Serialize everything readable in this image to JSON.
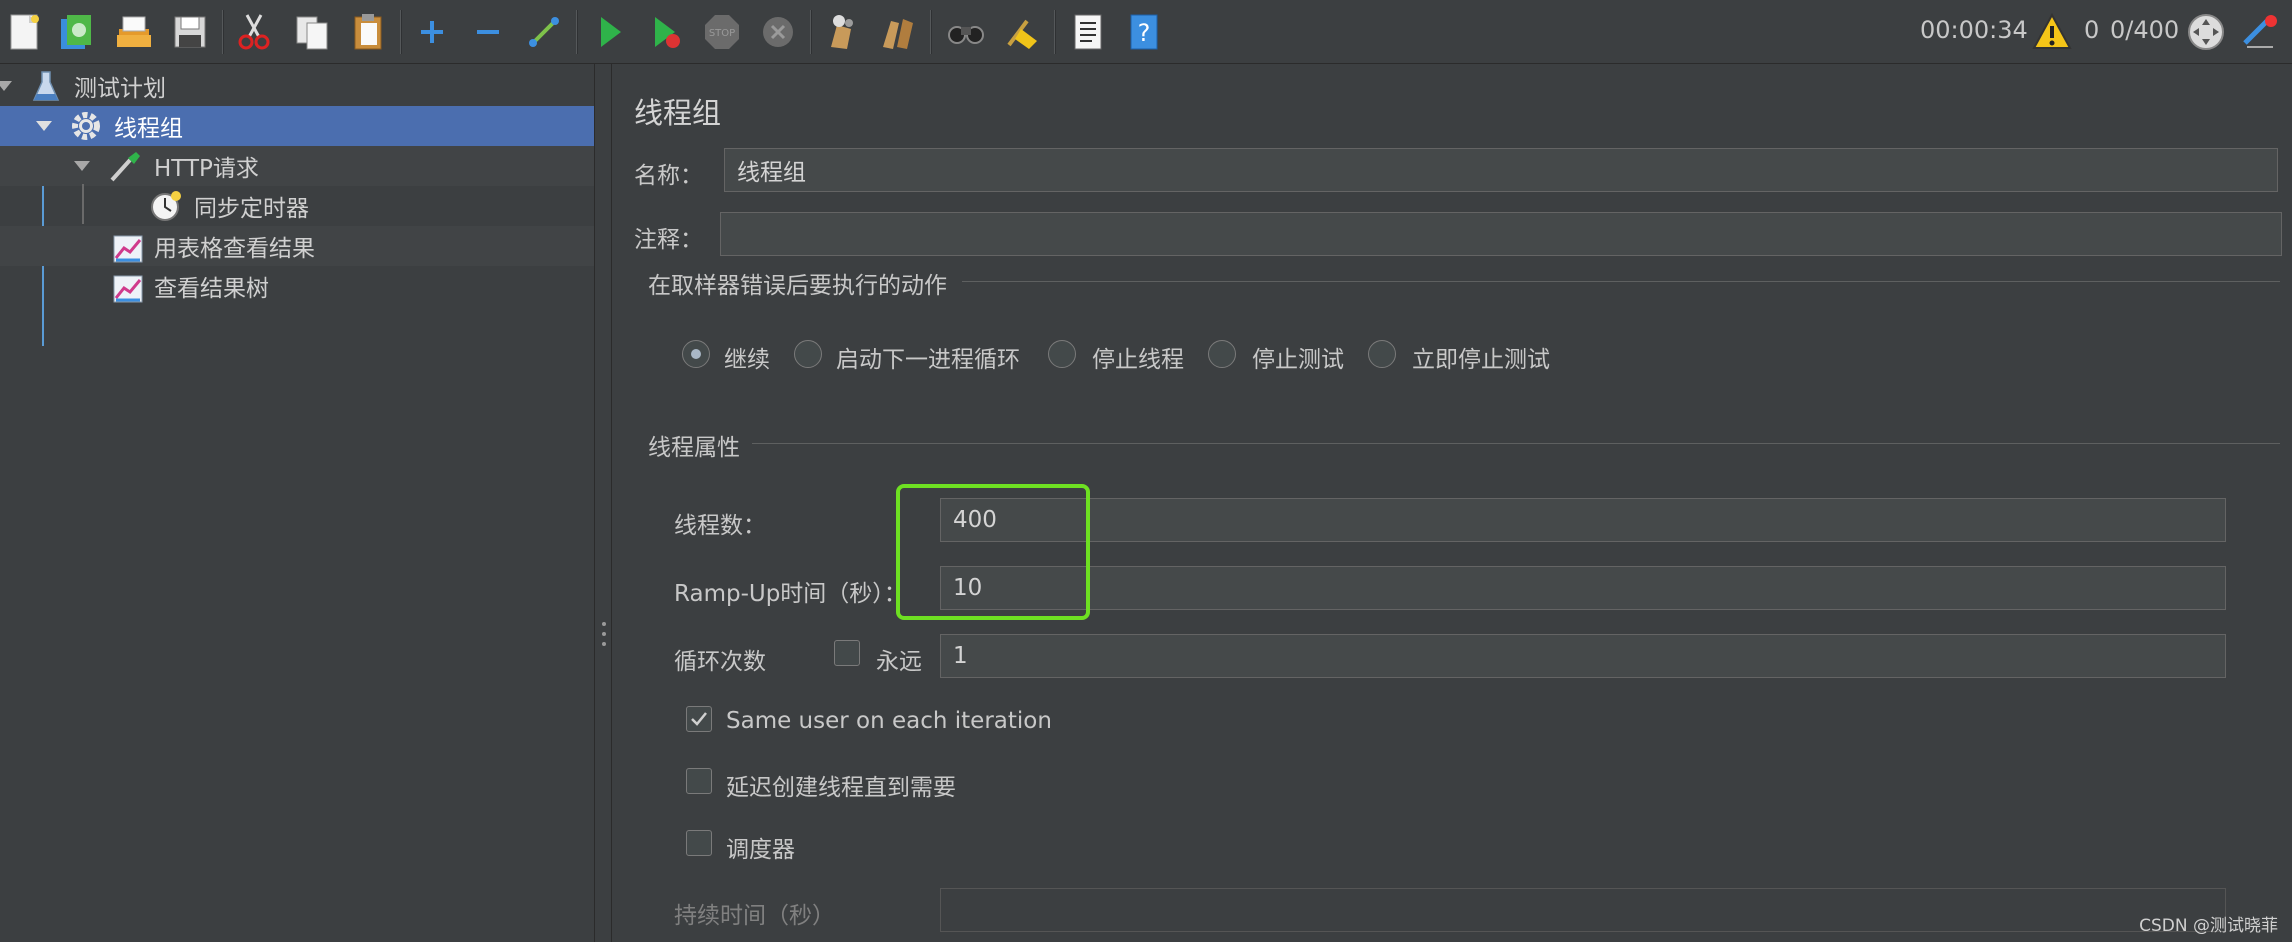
{
  "toolbar": {
    "buttons": [
      {
        "name": "new-icon"
      },
      {
        "name": "templates-icon"
      },
      {
        "name": "open-icon"
      },
      {
        "name": "save-icon"
      },
      {
        "name": "cut-icon"
      },
      {
        "name": "copy-icon"
      },
      {
        "name": "paste-icon"
      },
      {
        "name": "expand-icon"
      },
      {
        "name": "collapse-icon"
      },
      {
        "name": "toggle-icon"
      },
      {
        "name": "start-icon"
      },
      {
        "name": "start-no-pause-icon"
      },
      {
        "name": "stop-icon"
      },
      {
        "name": "shutdown-icon"
      },
      {
        "name": "clear-icon"
      },
      {
        "name": "clear-all-icon"
      },
      {
        "name": "search-icon"
      },
      {
        "name": "reset-search-icon"
      },
      {
        "name": "function-helper-icon"
      },
      {
        "name": "help-icon"
      }
    ],
    "elapsed_time": "00:00:34",
    "warning_count": "0",
    "threads_status": "0/400"
  },
  "tree": {
    "items": [
      {
        "label": "测试计划",
        "icon": "test-plan-icon"
      },
      {
        "label": "线程组",
        "icon": "gear-icon",
        "selected": true
      },
      {
        "label": "HTTP请求",
        "icon": "pipette-icon"
      },
      {
        "label": "同步定时器",
        "icon": "timer-icon"
      },
      {
        "label": "用表格查看结果",
        "icon": "chart-icon"
      },
      {
        "label": "查看结果树",
        "icon": "chart-icon"
      }
    ]
  },
  "panel": {
    "title": "线程组",
    "name_label": "名称：",
    "name_value": "线程组",
    "comment_label": "注释：",
    "comment_value": "",
    "error_group_title": "在取样器错误后要执行的动作",
    "error_actions": [
      {
        "label": "继续",
        "selected": true
      },
      {
        "label": "启动下一进程循环",
        "selected": false
      },
      {
        "label": "停止线程",
        "selected": false
      },
      {
        "label": "停止测试",
        "selected": false
      },
      {
        "label": "立即停止测试",
        "selected": false
      }
    ],
    "thread_group_title": "线程属性",
    "threads_label": "线程数：",
    "threads_value": "400",
    "rampup_label": "Ramp-Up时间（秒）：",
    "rampup_value": "10",
    "loop_label": "循环次数",
    "forever_label": "永远",
    "forever_checked": false,
    "loop_value": "1",
    "same_user_label": "Same user on each iteration",
    "same_user_checked": true,
    "delay_label": "延迟创建线程直到需要",
    "delay_checked": false,
    "scheduler_label": "调度器",
    "scheduler_checked": false,
    "duration_label": "持续时间（秒）",
    "duration_value": ""
  },
  "watermark": "CSDN @测试晓菲",
  "colors": {
    "selection": "#4b6eaf",
    "highlight": "#6ee022",
    "background": "#3c3f41"
  }
}
